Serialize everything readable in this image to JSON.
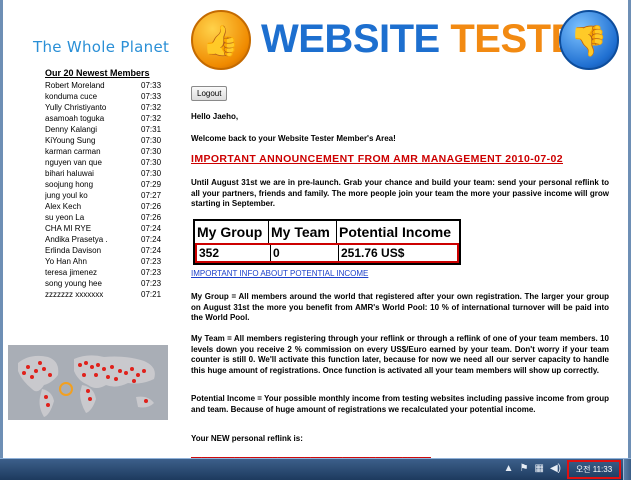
{
  "planet_title": "The Whole Planet",
  "members_heading": "Our 20 Newest Members",
  "members": [
    {
      "name": "Robert Moreland",
      "time": "07:33"
    },
    {
      "name": "konduma cuce",
      "time": "07:33"
    },
    {
      "name": "Yully Christiyanto",
      "time": "07:32"
    },
    {
      "name": "asamoah toguka",
      "time": "07:32"
    },
    {
      "name": "Denny Kalangi",
      "time": "07:31"
    },
    {
      "name": "KiYoung Sung",
      "time": "07:30"
    },
    {
      "name": "karman carman",
      "time": "07:30"
    },
    {
      "name": "nguyen van que",
      "time": "07:30"
    },
    {
      "name": "bihari haluwai",
      "time": "07:30"
    },
    {
      "name": "soojung hong",
      "time": "07:29"
    },
    {
      "name": "jung youl ko",
      "time": "07:27"
    },
    {
      "name": "Alex Kech",
      "time": "07:26"
    },
    {
      "name": "su yeon La",
      "time": "07:26"
    },
    {
      "name": "CHA MI RYE",
      "time": "07:24"
    },
    {
      "name": "Andika Prasetya .",
      "time": "07:24"
    },
    {
      "name": "Erlinda Davison",
      "time": "07:24"
    },
    {
      "name": "Yo Han Ahn",
      "time": "07:23"
    },
    {
      "name": "teresa jimenez",
      "time": "07:23"
    },
    {
      "name": "song young hee",
      "time": "07:23"
    },
    {
      "name": "zzzzzzz xxxxxxx",
      "time": "07:21"
    }
  ],
  "banner": {
    "word1": "WEBSITE",
    "word2": "TESTER",
    "color_blue": "#1d6fcf",
    "color_orange": "#f28a12"
  },
  "logout_label": "Logout",
  "hello": "Hello Jaeho,",
  "welcome": "Welcome back to your Website Tester Member's Area!",
  "announcement": "IMPORTANT ANNOUNCEMENT FROM AMR MANAGEMENT 2010-07-02",
  "prelaunch_text": "Until August 31st we are in pre-launch. Grab your chance and build your team: send your personal reflink to all your partners, friends and family. The more people join your team the more your passive income will grow starting in September.",
  "stats": {
    "headers": [
      "My Group",
      "My Team",
      "Potential Income"
    ],
    "values": [
      "352",
      "0",
      "251.76 US$"
    ]
  },
  "info_link": "IMPORTANT INFO ABOUT POTENTIAL INCOME",
  "my_group_text": "My Group = All members around the world that registered after your own registration. The larger your group on August 31st the more you benefit from AMR's World Pool: 10 % of international turnover will be paid into the World Pool.",
  "my_team_text": "My Team = All members registering through your reflink or through a reflink of one of your team members. 10 levels down you receive 2 % commission on every US$/Euro earned by your team. Don't worry if your team counter is still 0. We'll activate this function later, because for now we need all our server capacity to handle this huge amount of registrations. Once function is activated all your team members will show up correctly.",
  "potential_income_text": "Potential Income = Your possible monthly income from testing websites including passive income from group and team. Because of huge amount of registrations we recalculated your potential income.",
  "reflink_label": "Your NEW personal reflink is:",
  "taskbar": {
    "clock": "오전 11:33",
    "tray_icons": [
      "up-arrow-icon",
      "flag-icon",
      "network-icon",
      "volume-icon"
    ]
  }
}
